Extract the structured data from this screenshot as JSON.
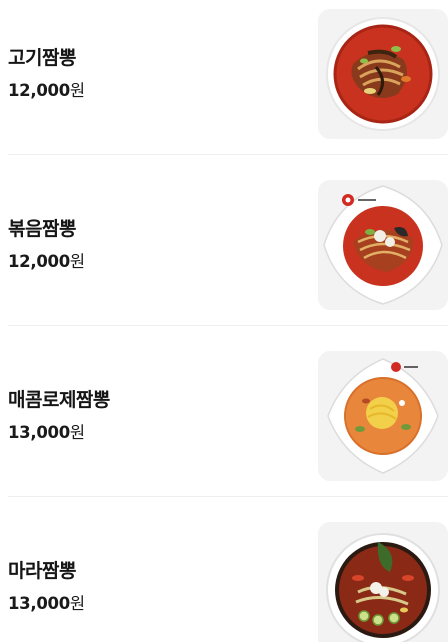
{
  "menu": {
    "items": [
      {
        "name": "고기짬뽕",
        "price": "12,000",
        "currency": "원",
        "image_icon": "gogi-jjamppong-dish-image"
      },
      {
        "name": "볶음짬뽕",
        "price": "12,000",
        "currency": "원",
        "image_icon": "bokkeum-jjamppong-dish-image"
      },
      {
        "name": "매콤로제짬뽕",
        "price": "13,000",
        "currency": "원",
        "image_icon": "maekom-rose-jjamppong-dish-image"
      },
      {
        "name": "마라짬뽕",
        "price": "13,000",
        "currency": "원",
        "image_icon": "mala-jjamppong-dish-image"
      }
    ]
  },
  "colors": {
    "thumb_bg": "#f3f3f3",
    "divider": "#efefef",
    "spicy_broth": "#c8321e",
    "rose_broth": "#e8873c"
  }
}
